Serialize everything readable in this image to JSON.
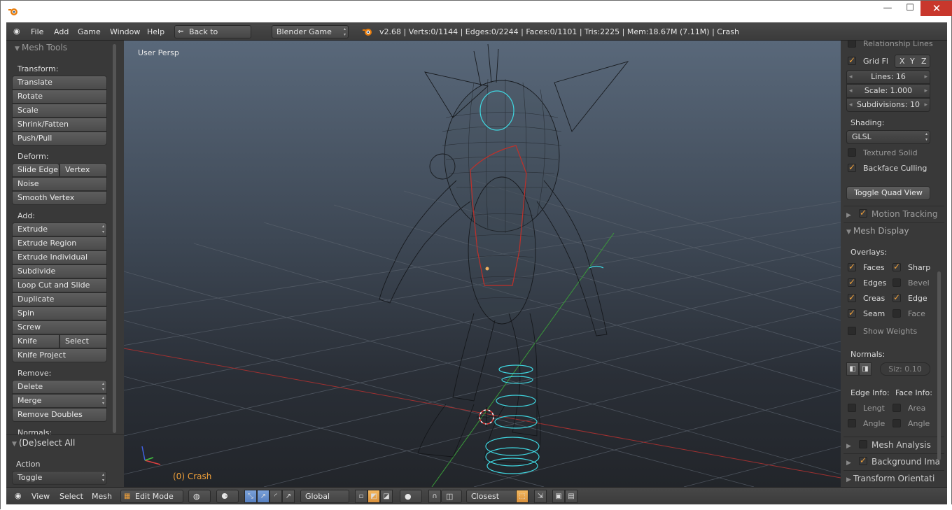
{
  "window": {
    "min_label": "—",
    "max_label": "☐",
    "close_label": "✕"
  },
  "menu": {
    "file": "File",
    "add": "Add",
    "game": "Game",
    "window": "Window",
    "help": "Help",
    "back": "Back to Previous",
    "engine": "Blender Game",
    "stats": "v2.68 | Verts:0/1144 | Edges:0/2244 | Faces:0/1101 | Tris:2225 | Mem:18.67M (7.11M) | Crash"
  },
  "toolshelf": {
    "header": "Mesh Tools",
    "transform": {
      "title": "Transform:",
      "items": [
        "Translate",
        "Rotate",
        "Scale",
        "Shrink/Fatten",
        "Push/Pull"
      ]
    },
    "deform": {
      "title": "Deform:",
      "slide_edge": "Slide Edge",
      "vertex": "Vertex",
      "noise": "Noise",
      "smooth_vertex": "Smooth Vertex"
    },
    "add": {
      "title": "Add:",
      "extrude": "Extrude",
      "items": [
        "Extrude Region",
        "Extrude Individual",
        "Subdivide",
        "Loop Cut and Slide",
        "Duplicate",
        "Spin",
        "Screw"
      ],
      "knife": "Knife",
      "select": "Select",
      "knife_project": "Knife Project"
    },
    "remove": {
      "title": "Remove:",
      "delete": "Delete",
      "merge": "Merge",
      "remove_doubles": "Remove Doubles"
    },
    "normals_title": "Normals:",
    "operator": {
      "header": "(De)select All",
      "action_label": "Action",
      "action_value": "Toggle"
    }
  },
  "viewport": {
    "label": "User Persp",
    "object": "(0) Crash"
  },
  "properties": {
    "relationship_lines": "Relationship Lines",
    "grid_floor": "Grid Fl",
    "axis_x": "X",
    "axis_y": "Y",
    "axis_z": "Z",
    "lines": "Lines: 16",
    "scale": "Scale: 1.000",
    "subdivisions": "Subdivisions: 10",
    "shading_title": "Shading:",
    "shading_value": "GLSL",
    "textured_solid": "Textured Solid",
    "backface_culling": "Backface Culling",
    "toggle_quad": "Toggle Quad View",
    "motion_tracking": "Motion Tracking",
    "mesh_display": "Mesh Display",
    "overlays": "Overlays:",
    "faces": "Faces",
    "sharp": "Sharp",
    "edges": "Edges",
    "bevel": "Bevel",
    "creas": "Creas",
    "edge": "Edge",
    "seam": "Seam",
    "face": "Face",
    "show_weights": "Show Weights",
    "normals": "Normals:",
    "normal_size": "Siz: 0.10",
    "edge_info": "Edge Info:",
    "face_info": "Face Info:",
    "length": "Lengt",
    "area": "Area",
    "angle1": "Angle",
    "angle2": "Angle",
    "mesh_analysis": "Mesh Analysis",
    "background_images": "Background Ima",
    "transform_orientations": "Transform Orientati"
  },
  "footer": {
    "view": "View",
    "select": "Select",
    "mesh": "Mesh",
    "mode": "Edit Mode",
    "orientation": "Global",
    "snap": "Closest"
  },
  "colors": {
    "accent": "#f0a03a",
    "selected_loop": "#3fd6e0",
    "active_face": "#c0302a"
  }
}
